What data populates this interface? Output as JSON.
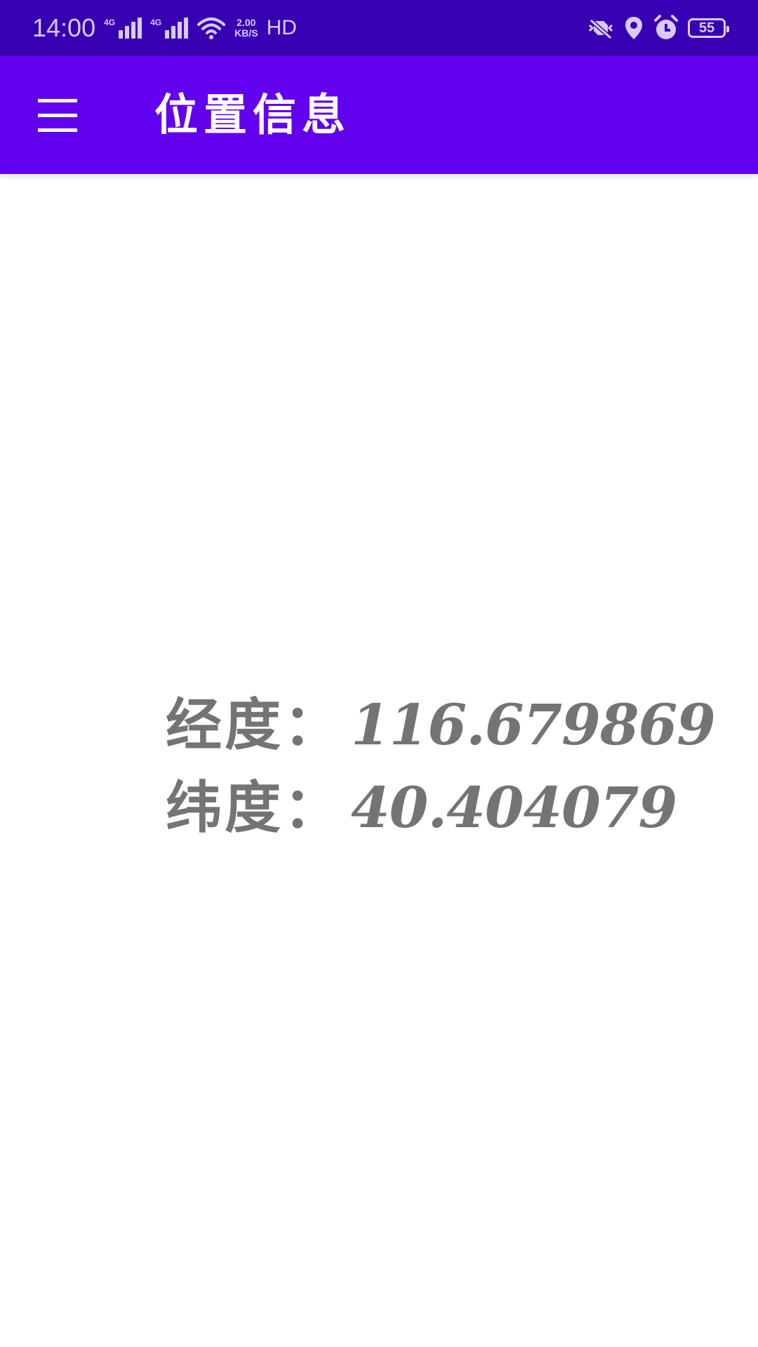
{
  "status_bar": {
    "time": "14:00",
    "network_1": "4G",
    "network_2": "4G",
    "speed_value": "2.00",
    "speed_unit": "KB/S",
    "hd": "HD",
    "battery": "55",
    "icons": [
      "signal-icon",
      "signal-icon",
      "wifi-icon",
      "vibrate-off-icon",
      "location-icon",
      "alarm-icon",
      "battery-icon"
    ]
  },
  "app_bar": {
    "title": "位置信息",
    "background": "#6200ee",
    "status_background": "#3700b3",
    "menu_icon": "hamburger-menu-icon"
  },
  "location": {
    "longitude_label": "经度：",
    "longitude_value": "116.679869",
    "latitude_label": "纬度：",
    "latitude_value": "40.404079",
    "text_color": "#747474"
  }
}
